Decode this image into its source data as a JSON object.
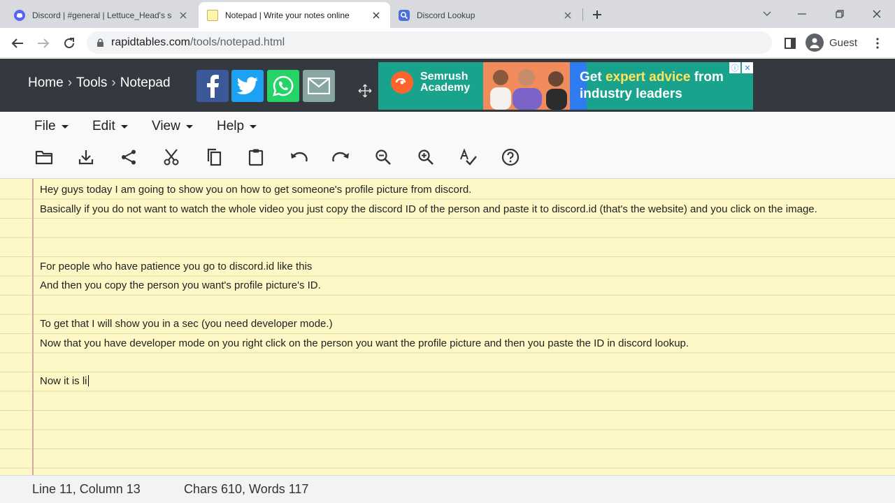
{
  "tabs": [
    {
      "title": "Discord | #general | Lettuce_Head's serv",
      "icon": "discord-icon"
    },
    {
      "title": "Notepad | Write your notes online",
      "icon": "notepad-icon"
    },
    {
      "title": "Discord Lookup",
      "icon": "search-icon"
    }
  ],
  "address": {
    "host": "rapidtables.com",
    "path": "/tools/notepad.html"
  },
  "profile": {
    "label": "Guest"
  },
  "breadcrumb": {
    "home": "Home",
    "tools": "Tools",
    "current": "Notepad",
    "separator": "›"
  },
  "ad": {
    "brand_line1": "Semrush",
    "brand_line2": "Academy",
    "headline_part1": "Get ",
    "headline_highlight": "expert advice",
    "headline_part2": " from",
    "headline_line2": "industry leaders"
  },
  "menus": {
    "file": "File",
    "edit": "Edit",
    "view": "View",
    "help": "Help"
  },
  "notepad": {
    "lines": [
      "Hey guys today I am going to show you on how to get someone's profile picture from discord.",
      "Basically if you do not want to watch the whole video you just copy the discord ID of the person and paste it to discord.id (that's the website) and you click on the image.",
      "",
      "",
      "For people who have patience you go to discord.id like this",
      "And then you copy the person you want's profile picture's ID.",
      "",
      "To get that I will show you in a sec (you need developer mode.)",
      "Now that you have developer mode on you right click on the person you want the profile picture and then you paste the ID in discord lookup.",
      "",
      "Now it is li"
    ]
  },
  "status": {
    "position": "Line 11, Column 13",
    "counts": "Chars 610, Words 117"
  },
  "colors": {
    "header_bg": "#33393f",
    "paper": "#fdf8c5",
    "facebook": "#3b5998",
    "twitter": "#1da1f2",
    "whatsapp": "#25d366",
    "email": "#8aa6a3",
    "ad_bg": "#1aa38c"
  }
}
